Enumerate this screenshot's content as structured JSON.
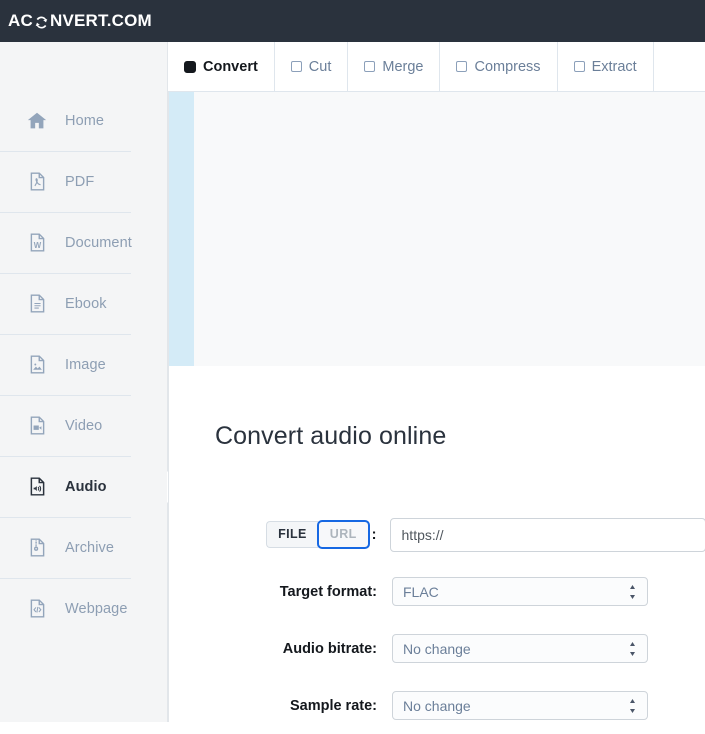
{
  "header": {
    "logo_prefix": "AC",
    "logo_icon": "refresh-circular-arrow-icon",
    "logo_suffix": "NVERT.COM",
    "background_color": "#2a323d"
  },
  "sidebar": {
    "items": [
      {
        "label": "Home",
        "icon": "home-icon",
        "active": false
      },
      {
        "label": "PDF",
        "icon": "pdf-file-icon",
        "active": false
      },
      {
        "label": "Document",
        "icon": "word-document-icon",
        "active": false
      },
      {
        "label": "Ebook",
        "icon": "ebook-file-icon",
        "active": false
      },
      {
        "label": "Image",
        "icon": "image-file-icon",
        "active": false
      },
      {
        "label": "Video",
        "icon": "video-file-icon",
        "active": false
      },
      {
        "label": "Audio",
        "icon": "audio-file-icon",
        "active": true
      },
      {
        "label": "Archive",
        "icon": "archive-zip-icon",
        "active": false
      },
      {
        "label": "Webpage",
        "icon": "webpage-code-icon",
        "active": false
      }
    ]
  },
  "tabs": [
    {
      "label": "Convert",
      "icon": "filled-square-icon",
      "active": true
    },
    {
      "label": "Cut",
      "icon": "outline-square-icon",
      "active": false
    },
    {
      "label": "Merge",
      "icon": "outline-square-icon",
      "active": false
    },
    {
      "label": "Compress",
      "icon": "outline-square-icon",
      "active": false
    },
    {
      "label": "Extract",
      "icon": "outline-square-icon",
      "active": false
    }
  ],
  "banner": {
    "strip_color": "#d4ebf7",
    "area_color": "#f8f9fa"
  },
  "main": {
    "title": "Convert audio online",
    "source_toggle": {
      "file_label": "FILE",
      "url_label": "URL",
      "selected": "URL",
      "colon": ":",
      "focus_color": "#1668e3"
    },
    "url_field": {
      "placeholder": "https://",
      "value": ""
    },
    "fields": [
      {
        "label": "Target format:",
        "value": "FLAC"
      },
      {
        "label": "Audio bitrate:",
        "value": "No change"
      },
      {
        "label": "Sample rate:",
        "value": "No change"
      }
    ]
  }
}
